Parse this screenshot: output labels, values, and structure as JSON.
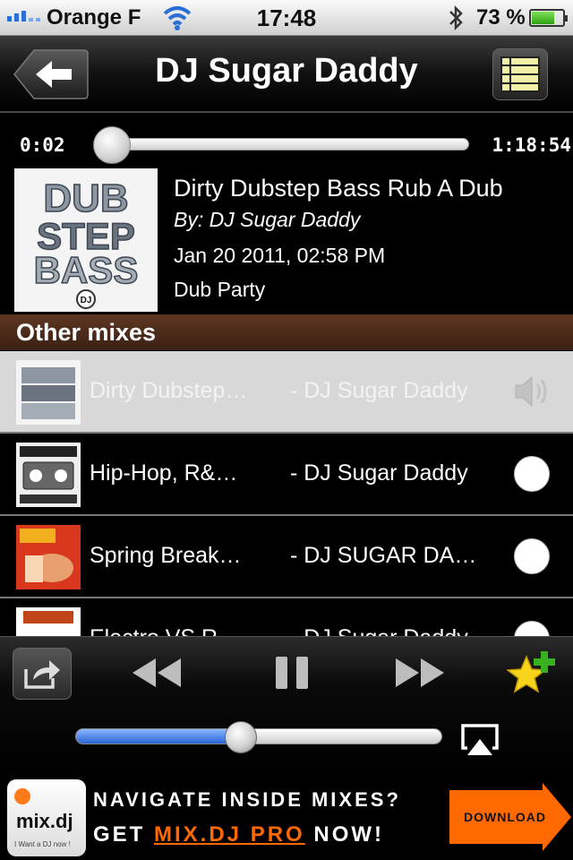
{
  "status_bar": {
    "carrier": "Orange F",
    "time": "17:48",
    "battery_pct": "73 %",
    "battery_level": 0.73,
    "icons": [
      "signal-icon",
      "wifi-icon",
      "bluetooth-icon",
      "battery-icon"
    ]
  },
  "nav": {
    "title": "DJ Sugar Daddy",
    "back_icon": "back-arrow-icon",
    "list_icon": "list-icon"
  },
  "progress": {
    "elapsed": "0:02",
    "total": "1:18:54",
    "position": 0.0004
  },
  "now_playing": {
    "title": "Dirty Dubstep Bass Rub A Dub",
    "artist": "By: DJ Sugar Daddy",
    "date": "Jan 20 2011, 02:58 PM",
    "genre": "Dub Party",
    "cover_text": [
      "DUB",
      "STEP",
      "BASS",
      "DJ"
    ]
  },
  "section": {
    "title": "Other mixes"
  },
  "mixes": [
    {
      "title": "Dirty Dubstep…",
      "dj": "- DJ Sugar Daddy",
      "state": "playing"
    },
    {
      "title": "Hip-Hop, R&…",
      "dj": "- DJ Sugar Daddy",
      "state": "idle"
    },
    {
      "title": "Spring Break…",
      "dj": "- DJ SUGAR DA…",
      "state": "idle"
    },
    {
      "title": "Electro VS R…",
      "dj": "- DJ Sugar Daddy",
      "state": "idle"
    }
  ],
  "controls": {
    "icons": [
      "share-icon",
      "rewind-icon",
      "pause-icon",
      "fast-forward-icon",
      "favorite-add-icon",
      "airplay-icon"
    ],
    "volume": 0.45
  },
  "ad": {
    "logo_word": "mix.dj",
    "logo_sub": "I Want a DJ now !",
    "line1": "NAVIGATE INSIDE MIXES?",
    "line2_pre": "GET ",
    "line2_hl": "MIX.DJ PRO",
    "line2_post": " NOW!",
    "download": "DOWNLOAD"
  },
  "colors": {
    "section_header": "#5e3621",
    "accent_orange": "#ff6a00",
    "volume_blue": "#2a63d6"
  }
}
